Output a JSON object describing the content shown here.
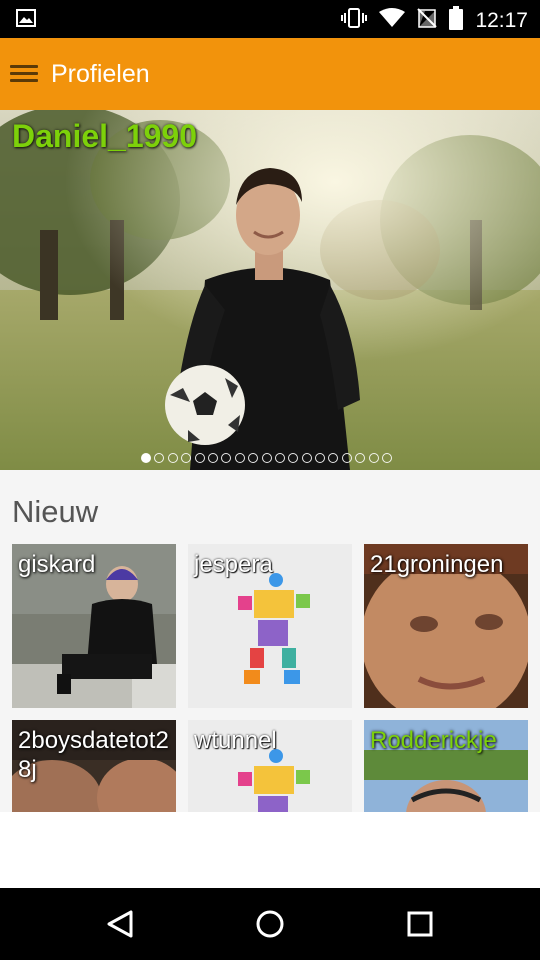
{
  "status_bar": {
    "time": "12:17",
    "icons": [
      "image-icon",
      "vibrate-icon",
      "wifi-icon",
      "no-sim-icon",
      "battery-icon"
    ]
  },
  "app_bar": {
    "title": "Profielen",
    "menu_icon": "hamburger-menu-icon"
  },
  "featured": {
    "name": "Daniel_1990",
    "name_color": "#7dd10a",
    "pager": {
      "count": 19,
      "active_index": 0
    }
  },
  "section": {
    "title": "Nieuw"
  },
  "profiles": [
    {
      "name": "giskard",
      "name_color": "#ffffff",
      "photo": "man-sitting-on-bench"
    },
    {
      "name": "jespera",
      "name_color": "#ffffff",
      "photo": "default-avatar-figure"
    },
    {
      "name": "21groningen",
      "name_color": "#ffffff",
      "photo": "face-closeup"
    },
    {
      "name": "2boysdatetot28j",
      "name_color": "#ffffff",
      "photo": "two-faces"
    },
    {
      "name": "wtunnel",
      "name_color": "#ffffff",
      "photo": "default-avatar-figure"
    },
    {
      "name": "Rodderickje",
      "name_color": "#7dd10a",
      "photo": "man-with-glasses"
    }
  ],
  "nav_bar": {
    "icons": [
      "back-icon",
      "home-icon",
      "recents-icon"
    ]
  },
  "colors": {
    "accent": "#f2930c",
    "highlight_name": "#7dd10a"
  }
}
